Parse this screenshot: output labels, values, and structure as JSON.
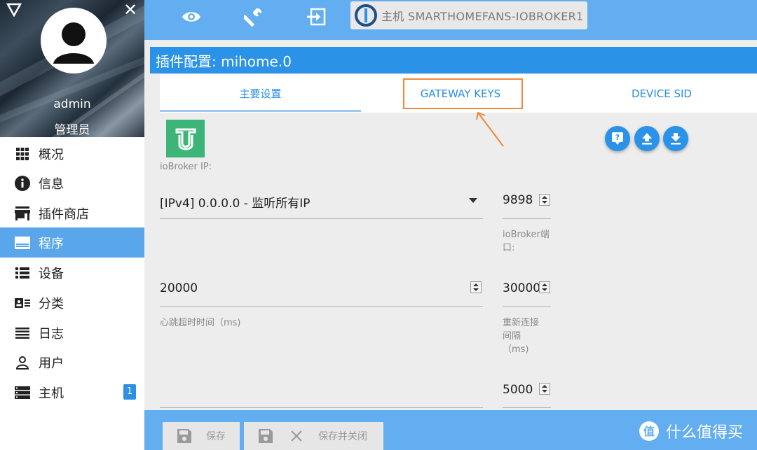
{
  "sidebar": {
    "username": "admin",
    "role": "管理员",
    "items": [
      {
        "label": "概况",
        "icon": "grid-icon"
      },
      {
        "label": "信息",
        "icon": "info-icon"
      },
      {
        "label": "插件商店",
        "icon": "store-icon"
      },
      {
        "label": "程序",
        "icon": "instances-icon",
        "active": true
      },
      {
        "label": "设备",
        "icon": "list-icon"
      },
      {
        "label": "分类",
        "icon": "category-icon"
      },
      {
        "label": "日志",
        "icon": "log-icon"
      },
      {
        "label": "用户",
        "icon": "user-icon"
      },
      {
        "label": "主机",
        "icon": "hosts-icon",
        "badge": "1"
      }
    ]
  },
  "topbar": {
    "icons": [
      "eye-icon",
      "wrench-icon",
      "exit-icon"
    ],
    "host": "主机 SMARTHOMEFANS-IOBROKER1"
  },
  "config": {
    "title": "插件配置: mihome.0",
    "tabs": [
      "主要设置",
      "GATEWAY KEYS",
      "DEVICE SID"
    ],
    "active_tab": 0
  },
  "form": {
    "iobroker_ip_label": "ioBroker IP:",
    "iobroker_ip_value": "[IPv4] 0.0.0.0 - 监听所有IP",
    "iobroker_port_value": "9898",
    "iobroker_port_label_1": "ioBroker端",
    "iobroker_port_label_2": "口:",
    "heartbeat_value": "20000",
    "heartbeat_label": "心跳超时时间（ms)",
    "reconnect_value": "30000",
    "reconnect_label_1": "重新连接",
    "reconnect_label_2": "间隔",
    "reconnect_label_3": "（ms)",
    "extra_value": "5000"
  },
  "bottombar": {
    "save_label": "保存",
    "save_close_label": "保存并关闭"
  },
  "watermark": "什么值得买",
  "colors": {
    "primary": "#2a93e8",
    "topbar": "#63aef0",
    "highlight": "#f0893a",
    "mi_green": "#3db579"
  }
}
